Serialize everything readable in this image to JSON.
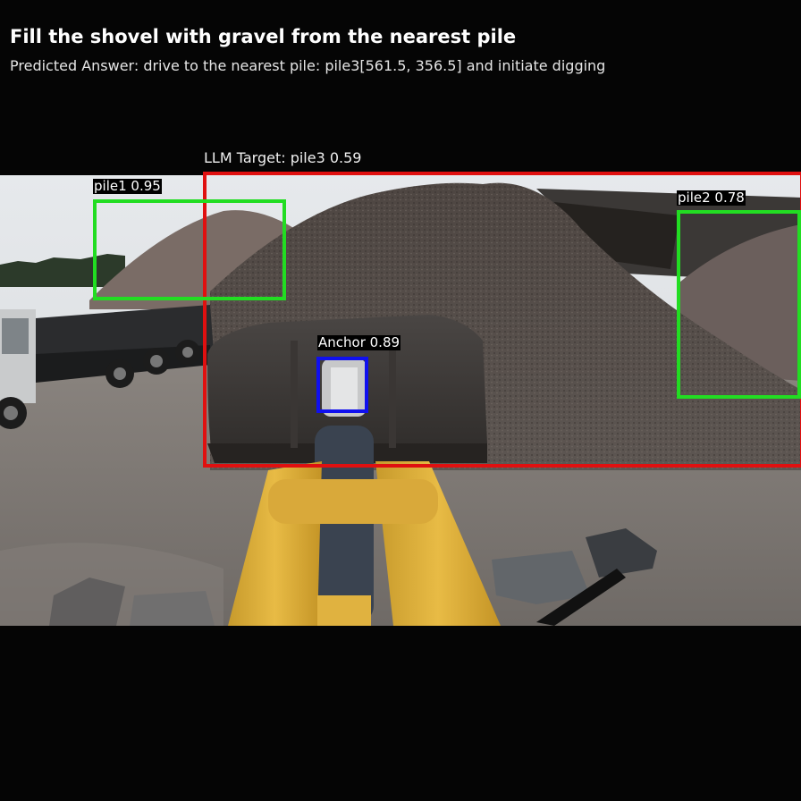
{
  "header": {
    "title": "Fill the shovel with gravel from the nearest pile",
    "predicted_answer": "Predicted Answer: drive to the nearest pile: pile3[561.5, 356.5] and initiate digging"
  },
  "llm_target": {
    "label": "LLM Target: pile3 0.59",
    "color": "#e01010"
  },
  "detections": {
    "pile1": {
      "label": "pile1 0.95",
      "color": "#22dd22"
    },
    "pile2": {
      "label": "pile2 0.78",
      "color": "#22dd22"
    },
    "anchor": {
      "label": "Anchor 0.89",
      "color": "#1010ee"
    }
  },
  "scene": {
    "description_icon": "wheel-loader-cab-view-icon"
  }
}
